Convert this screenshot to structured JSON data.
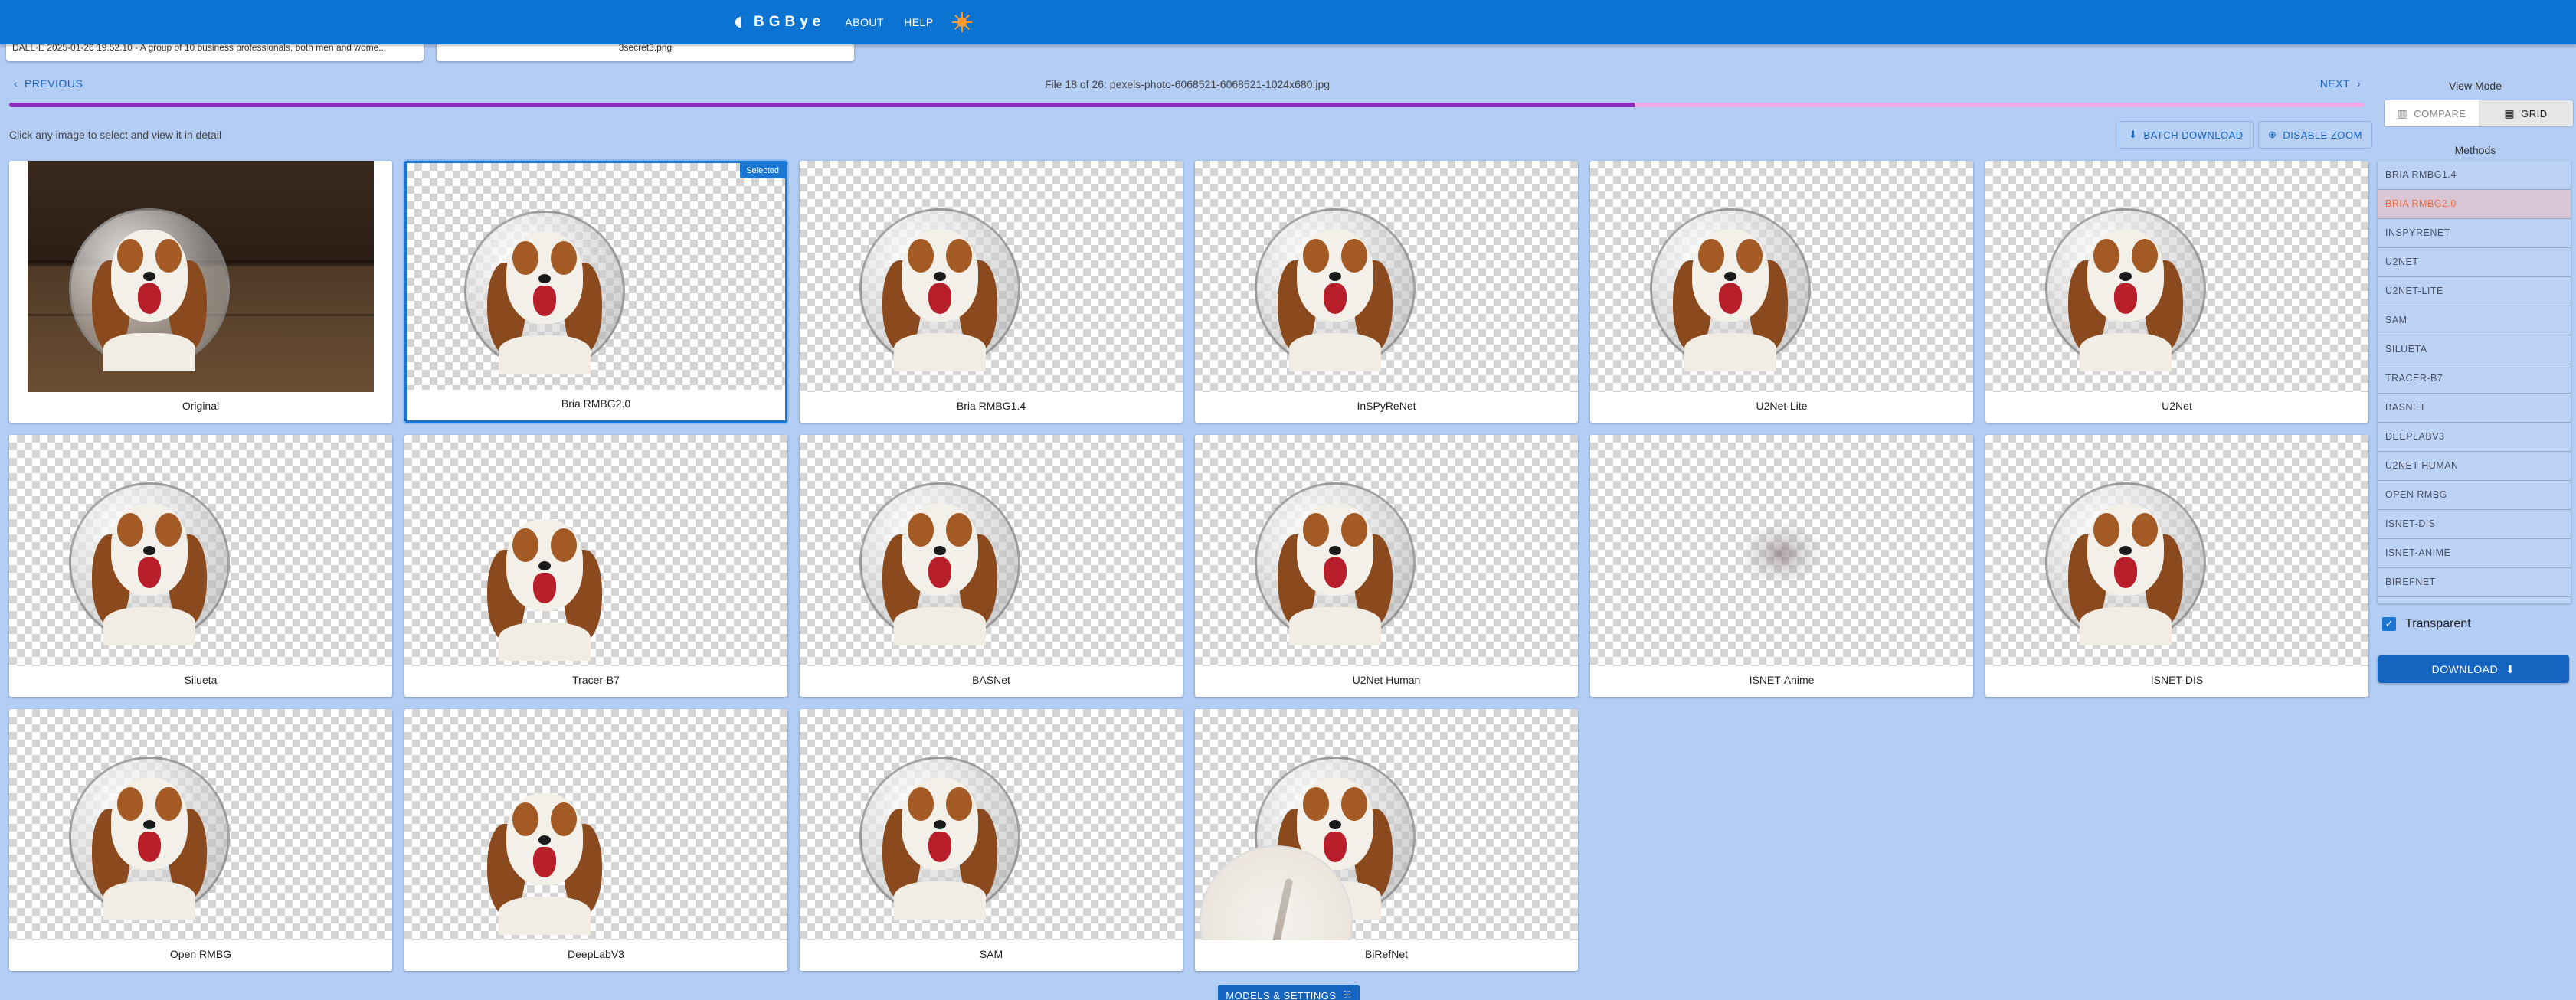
{
  "app": {
    "brand": "BGBye",
    "nav": [
      "ABOUT",
      "HELP"
    ]
  },
  "file_selectors": {
    "left": "DALL·E 2025-01-26 19.52.10 - A group of 10 business professionals, both men and wome...",
    "right": "3secret3.png"
  },
  "file_nav": {
    "previous": "PREVIOUS",
    "next": "NEXT",
    "counter": "File 18 of 26: pexels-photo-6068521-6068521-1024x680.jpg",
    "progress_fraction": 0.69
  },
  "toolbar": {
    "hint": "Click any image to select and view it in detail",
    "batch_download": "BATCH DOWNLOAD",
    "disable_zoom": "DISABLE ZOOM"
  },
  "grid": {
    "selected_badge": "Selected",
    "cards": [
      {
        "label": "Original"
      },
      {
        "label": "Bria RMBG2.0"
      },
      {
        "label": "Bria RMBG1.4"
      },
      {
        "label": "InSPyReNet"
      },
      {
        "label": "U2Net-Lite"
      },
      {
        "label": "U2Net"
      },
      {
        "label": "Silueta"
      },
      {
        "label": "Tracer-B7"
      },
      {
        "label": "BASNet"
      },
      {
        "label": "U2Net Human"
      },
      {
        "label": "ISNET-Anime"
      },
      {
        "label": "ISNET-DIS"
      },
      {
        "label": "Open RMBG"
      },
      {
        "label": "DeepLabV3"
      },
      {
        "label": "SAM"
      },
      {
        "label": "BiRefNet"
      }
    ]
  },
  "panel": {
    "view_mode_title": "View Mode",
    "compare": "COMPARE",
    "grid": "GRID",
    "methods_title": "Methods",
    "methods": [
      "BRIA RMBG1.4",
      "BRIA RMBG2.0",
      "INSPYRENET",
      "U2NET",
      "U2NET-LITE",
      "SAM",
      "SILUETA",
      "TRACER-B7",
      "BASNET",
      "DEEPLABV3",
      "U2NET HUMAN",
      "OPEN RMBG",
      "ISNET-DIS",
      "ISNET-ANIME",
      "BIREFNET"
    ],
    "active_method": "BRIA RMBG2.0",
    "transparent_label": "Transparent",
    "download": "DOWNLOAD"
  },
  "footer": {
    "models_settings": "MODELS & SETTINGS"
  },
  "colors": {
    "appbar": "#0b73d2",
    "background": "#b3cdf5",
    "progress": "#8e2bbf",
    "active_method_text": "#f26a3d"
  }
}
